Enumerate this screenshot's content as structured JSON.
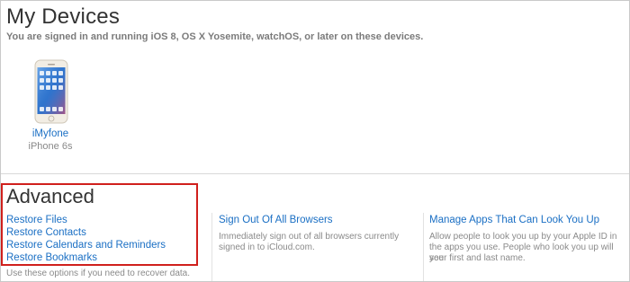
{
  "devices_section": {
    "title": "My Devices",
    "subtitle": "You are signed in and running iOS 8, OS X Yosemite, watchOS, or later on these devices.",
    "devices": [
      {
        "name": "iMyfone",
        "model": "iPhone 6s"
      }
    ]
  },
  "advanced_section": {
    "title": "Advanced",
    "restore_links": [
      "Restore Files",
      "Restore Contacts",
      "Restore Calendars and Reminders",
      "Restore Bookmarks"
    ],
    "restore_note": "Use these options if you need to recover data.",
    "sign_out": {
      "label": "Sign Out Of All Browsers",
      "desc_line1": "Immediately sign out of all browsers currently",
      "desc_line2": "signed in to iCloud.com."
    },
    "manage_apps": {
      "label": "Manage Apps That Can Look You Up",
      "desc_line1": "Allow people to look you up by your Apple ID in",
      "desc_line2": "the apps you use. People who look you up will see",
      "desc_line3": "your first and last name."
    }
  },
  "colors": {
    "link": "#1a6fc4",
    "highlight_border": "#d0201d"
  }
}
